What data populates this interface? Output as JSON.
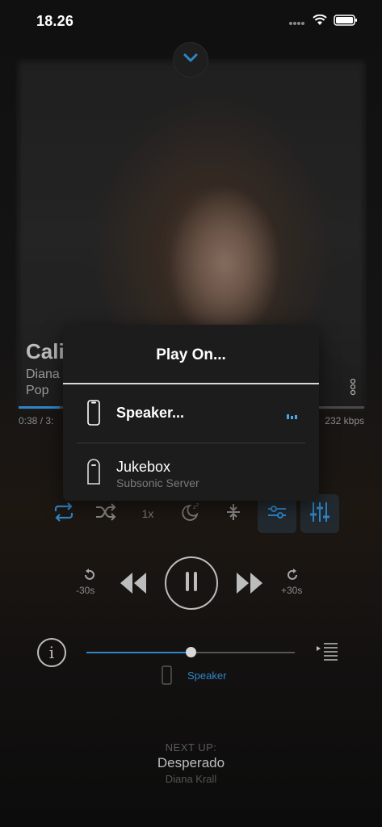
{
  "status_bar": {
    "time": "18.26",
    "icons": [
      "signal-dots-icon",
      "wifi-icon",
      "battery-icon"
    ]
  },
  "now_playing": {
    "title": "Cali",
    "artist": "Diana",
    "genre": "Pop",
    "elapsed": "0:38 / 3:",
    "bitrate": "232 kbps",
    "progress": 0.12
  },
  "controls": {
    "speed_label": "1x",
    "skip_back_label": "-30s",
    "skip_forward_label": "+30s",
    "icons": [
      "repeat-icon",
      "shuffle-icon",
      "speed",
      "sleep-timer-icon",
      "collapse-arrows-icon",
      "filter-icon",
      "equalizer-icon"
    ]
  },
  "volume": {
    "level": 0.5,
    "route_label": "Speaker"
  },
  "next_up": {
    "label": "NEXT UP:",
    "title": "Desperado",
    "artist": "Diana Krall"
  },
  "play_on_popup": {
    "title": "Play On...",
    "devices": [
      {
        "name": "Speaker...",
        "subtitle": "",
        "active": true,
        "icon": "phone-icon"
      },
      {
        "name": "Jukebox",
        "subtitle": "Subsonic Server",
        "active": false,
        "icon": "server-icon"
      }
    ]
  },
  "colors": {
    "accent": "#2f86c5",
    "active_indicator": "#4aa6e8",
    "background": "#141414",
    "popup": "#1c1c1c"
  }
}
